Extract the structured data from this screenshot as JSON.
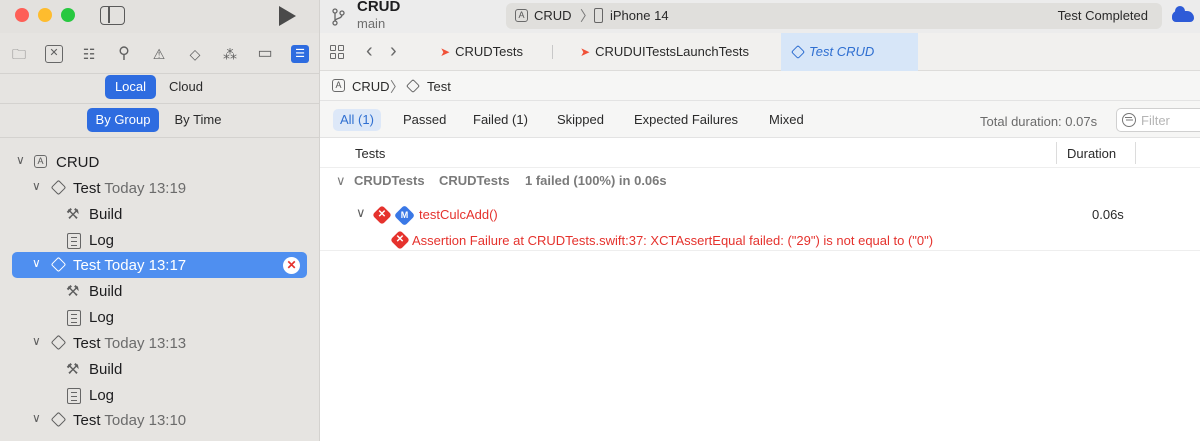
{
  "window": {
    "project": "CRUD",
    "branch": "main",
    "scheme": "CRUD",
    "device": "iPhone 14",
    "status": "Test Completed"
  },
  "navigator": {
    "icons": [
      "folder-icon",
      "source-control-icon",
      "symbol-icon",
      "search-icon",
      "warning-icon",
      "test-icon",
      "debug-icon",
      "breakpoint-icon",
      "report-icon"
    ],
    "scope": {
      "local": "Local",
      "cloud": "Cloud"
    },
    "grouping": {
      "by_group": "By Group",
      "by_time": "By Time"
    },
    "tree": {
      "root": "CRUD",
      "runs": [
        {
          "label": "Test",
          "time": "Today 13:19",
          "children": [
            "Build",
            "Log"
          ]
        },
        {
          "label": "Test",
          "time": "Today 13:17",
          "children": [
            "Build",
            "Log"
          ]
        },
        {
          "label": "Test",
          "time": "Today 13:13",
          "children": [
            "Build",
            "Log"
          ]
        },
        {
          "label": "Test",
          "time": "Today 13:10"
        }
      ]
    }
  },
  "editor": {
    "tabs": [
      "CRUDTests",
      "CRUDUITestsLaunchTests",
      "Test CRUD"
    ],
    "breadcrumb": {
      "project": "CRUD",
      "item": "Test"
    },
    "filters": [
      "All (1)",
      "Passed",
      "Failed (1)",
      "Skipped",
      "Expected Failures",
      "Mixed"
    ],
    "total_duration": "Total duration: 0.07s",
    "filter_placeholder": "Filter",
    "columns": {
      "tests": "Tests",
      "duration": "Duration"
    },
    "group": {
      "name": "CRUDTests",
      "target": "CRUDTests",
      "summary": "1 failed (100%) in 0.06s"
    },
    "test": {
      "name": "testCulcAdd()",
      "duration": "0.06s",
      "method_badge": "M"
    },
    "failure": "Assertion Failure at CRUDTests.swift:37: XCTAssertEqual failed: (\"29\") is not equal to (\"0\")"
  },
  "colors": {
    "accent": "#2e6ce0",
    "selection": "#4f8ff0",
    "failure": "#e5322d"
  }
}
